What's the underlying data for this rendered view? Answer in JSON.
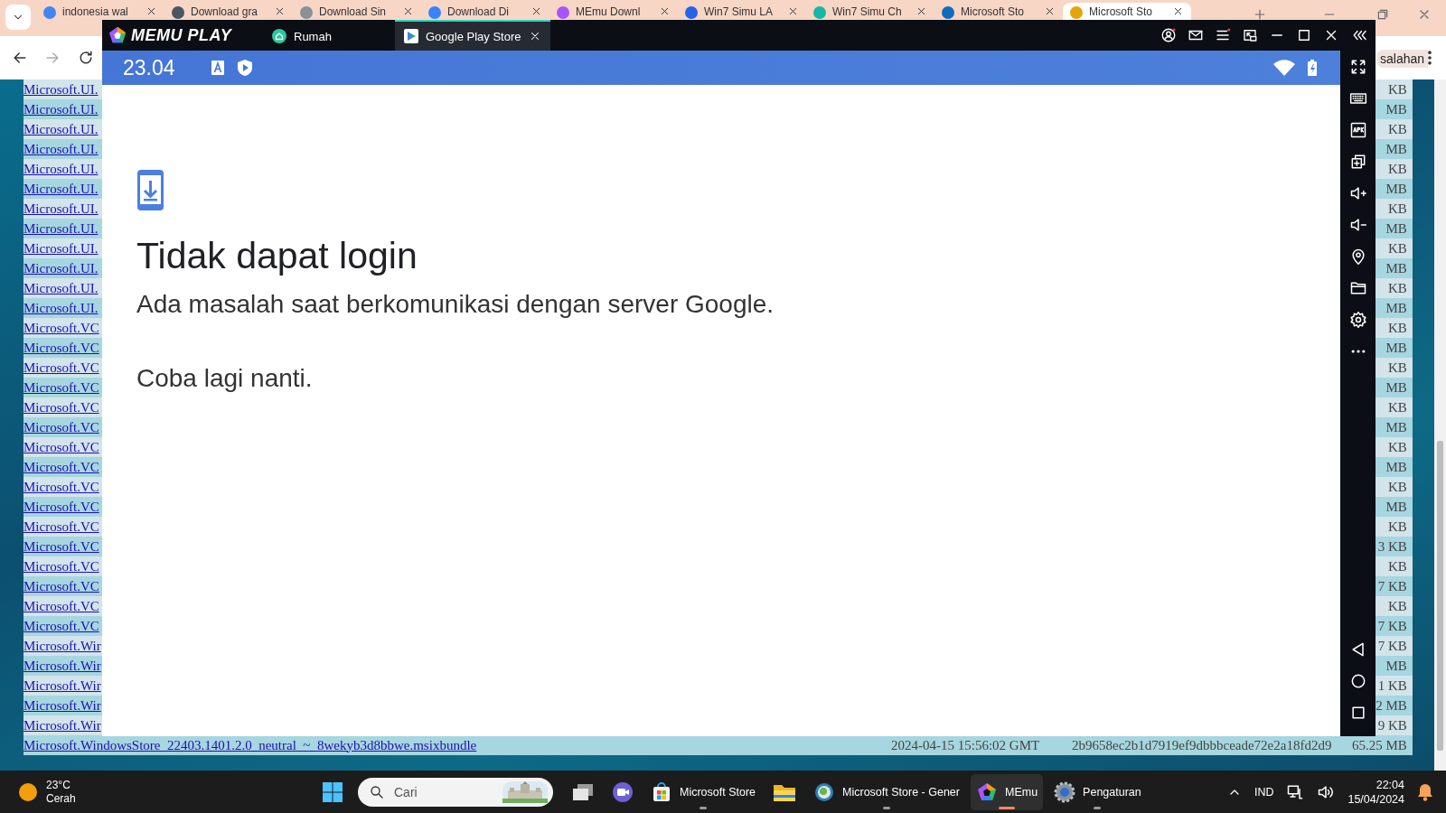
{
  "browser": {
    "tabs": [
      {
        "title": "indonesia wal",
        "selected": false,
        "color": "#4285f4"
      },
      {
        "title": "Download gra",
        "selected": false,
        "color": "#4b5563"
      },
      {
        "title": "Download Sin",
        "selected": false,
        "color": "#8b8f96"
      },
      {
        "title": "Download Di",
        "selected": false,
        "color": "#3b82f6"
      },
      {
        "title": "MEmu Downl",
        "selected": false,
        "color": "#a855f7"
      },
      {
        "title": "Win7 Simu LA",
        "selected": false,
        "color": "#2563eb"
      },
      {
        "title": "Win7 Simu Ch",
        "selected": false,
        "color": "#14b8a6"
      },
      {
        "title": "Microsoft Sto",
        "selected": false,
        "color": "#0f6cbd"
      },
      {
        "title": "Microsoft Sto",
        "selected": true,
        "color": "#e5a50a"
      }
    ],
    "toolbar_text": "salahan",
    "rows": [
      {
        "name": "Microsoft.UI.",
        "size": "KB"
      },
      {
        "name": "Microsoft.UI.",
        "size": "MB"
      },
      {
        "name": "Microsoft.UI.",
        "size": "KB"
      },
      {
        "name": "Microsoft.UI.",
        "size": "MB"
      },
      {
        "name": "Microsoft.UI.",
        "size": "KB"
      },
      {
        "name": "Microsoft.UI.",
        "size": "MB"
      },
      {
        "name": "Microsoft.UI.",
        "size": "KB"
      },
      {
        "name": "Microsoft.UI.",
        "size": "MB"
      },
      {
        "name": "Microsoft.UI.",
        "size": "KB"
      },
      {
        "name": "Microsoft.UI.",
        "size": "MB"
      },
      {
        "name": "Microsoft.UI.",
        "size": "KB"
      },
      {
        "name": "Microsoft.UI.",
        "size": "MB"
      },
      {
        "name": "Microsoft.VC",
        "size": "KB"
      },
      {
        "name": "Microsoft.VC",
        "size": "MB"
      },
      {
        "name": "Microsoft.VC",
        "size": "KB"
      },
      {
        "name": "Microsoft.VC",
        "size": "MB"
      },
      {
        "name": "Microsoft.VC",
        "size": "KB"
      },
      {
        "name": "Microsoft.VC",
        "size": "MB"
      },
      {
        "name": "Microsoft.VC",
        "size": "KB"
      },
      {
        "name": "Microsoft.VC",
        "size": "MB"
      },
      {
        "name": "Microsoft.VC",
        "size": "KB"
      },
      {
        "name": "Microsoft.VC",
        "size": "MB"
      },
      {
        "name": "Microsoft.VC",
        "size": "KB"
      },
      {
        "name": "Microsoft.VC",
        "size": "3 KB"
      },
      {
        "name": "Microsoft.VC",
        "size": "KB"
      },
      {
        "name": "Microsoft.VC",
        "size": "7 KB"
      },
      {
        "name": "Microsoft.VC",
        "size": "KB"
      },
      {
        "name": "Microsoft.VC",
        "size": "7 KB"
      },
      {
        "name": "Microsoft.Wir",
        "size": "7 KB"
      },
      {
        "name": "Microsoft.Wir",
        "size": "MB"
      },
      {
        "name": "Microsoft.Wir",
        "size": "1 KB"
      },
      {
        "name": "Microsoft.Wir",
        "size": "2 MB"
      },
      {
        "name": "Microsoft.Wir",
        "size": "9 KB"
      },
      {
        "name": "Microsoft.WindowsStore_22403.1401.2.0_neutral_~_8wekyb3d8bbwe.msixbundle",
        "date": "2024-04-15 15:56:02 GMT",
        "hash": "2b9658ec2b1d7919ef9dbbbceade72e2a18fd2d9",
        "size": "65.25 MB"
      }
    ]
  },
  "emulator": {
    "brand": "MEMU PLAY",
    "tabs": [
      {
        "label": "Rumah",
        "selected": false
      },
      {
        "label": "Google Play Store",
        "selected": true
      }
    ],
    "status_time": "23.04",
    "message": {
      "title": "Tidak dapat login",
      "body": "Ada masalah saat berkomunikasi dengan server Google.",
      "hint": "Coba lagi nanti."
    }
  },
  "taskbar": {
    "weather": {
      "temperature": "23°C",
      "condition": "Cerah"
    },
    "search": {
      "placeholder": "Cari"
    },
    "apps": [
      {
        "kind": "task-view",
        "selected": false,
        "running": false
      },
      {
        "kind": "chat",
        "selected": false,
        "running": false
      },
      {
        "kind": "store",
        "label": "Microsoft Store",
        "selected": false,
        "running": true
      },
      {
        "kind": "explorer",
        "selected": false,
        "running": false
      },
      {
        "kind": "browser",
        "label": "Microsoft Store - Gener",
        "selected": false,
        "running": true
      },
      {
        "kind": "memu",
        "label": "MEmu",
        "selected": true,
        "running": true
      },
      {
        "kind": "settings",
        "label": "Pengaturan",
        "selected": false,
        "running": true
      }
    ],
    "language": "IND",
    "time": "22:04",
    "date": "15/04/2024"
  }
}
